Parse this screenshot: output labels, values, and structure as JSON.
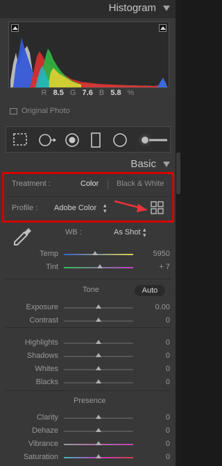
{
  "histogram": {
    "title": "Histogram",
    "r_label": "R",
    "r_value": "8.5",
    "g_label": "G",
    "g_value": "7.6",
    "b_label": "B",
    "b_value": "5.8",
    "percent": "%",
    "original_photo": "Original Photo"
  },
  "tools": [
    "crop-overlay-icon",
    "spot-removal-icon",
    "red-eye-icon",
    "graduated-filter-icon",
    "radial-filter-icon",
    "adjustment-brush-icon"
  ],
  "basic": {
    "title": "Basic",
    "treatment_label": "Treatment :",
    "treatment_color": "Color",
    "treatment_bw": "Black & White",
    "profile_label": "Profile :",
    "profile_value": "Adobe Color",
    "wb_label": "WB :",
    "wb_value": "As Shot",
    "tone_label": "Tone",
    "auto_label": "Auto",
    "presence_label": "Presence"
  },
  "sliders": {
    "temp": {
      "label": "Temp",
      "value": "5950",
      "pos": 0.45
    },
    "tint": {
      "label": "Tint",
      "value": "+ 7",
      "pos": 0.52
    },
    "exposure": {
      "label": "Exposure",
      "value": "0.00",
      "pos": 0.5
    },
    "contrast": {
      "label": "Contrast",
      "value": "0",
      "pos": 0.5
    },
    "highlights": {
      "label": "Highlights",
      "value": "0",
      "pos": 0.5
    },
    "shadows": {
      "label": "Shadows",
      "value": "0",
      "pos": 0.5
    },
    "whites": {
      "label": "Whites",
      "value": "0",
      "pos": 0.5
    },
    "blacks": {
      "label": "Blacks",
      "value": "0",
      "pos": 0.5
    },
    "clarity": {
      "label": "Clarity",
      "value": "0",
      "pos": 0.5
    },
    "dehaze": {
      "label": "Dehaze",
      "value": "0",
      "pos": 0.5
    },
    "vibrance": {
      "label": "Vibrance",
      "value": "0",
      "pos": 0.5
    },
    "saturation": {
      "label": "Saturation",
      "value": "0",
      "pos": 0.5
    }
  },
  "colors": {
    "highlight_box": "#d40000",
    "arrow": "#e8333a"
  }
}
